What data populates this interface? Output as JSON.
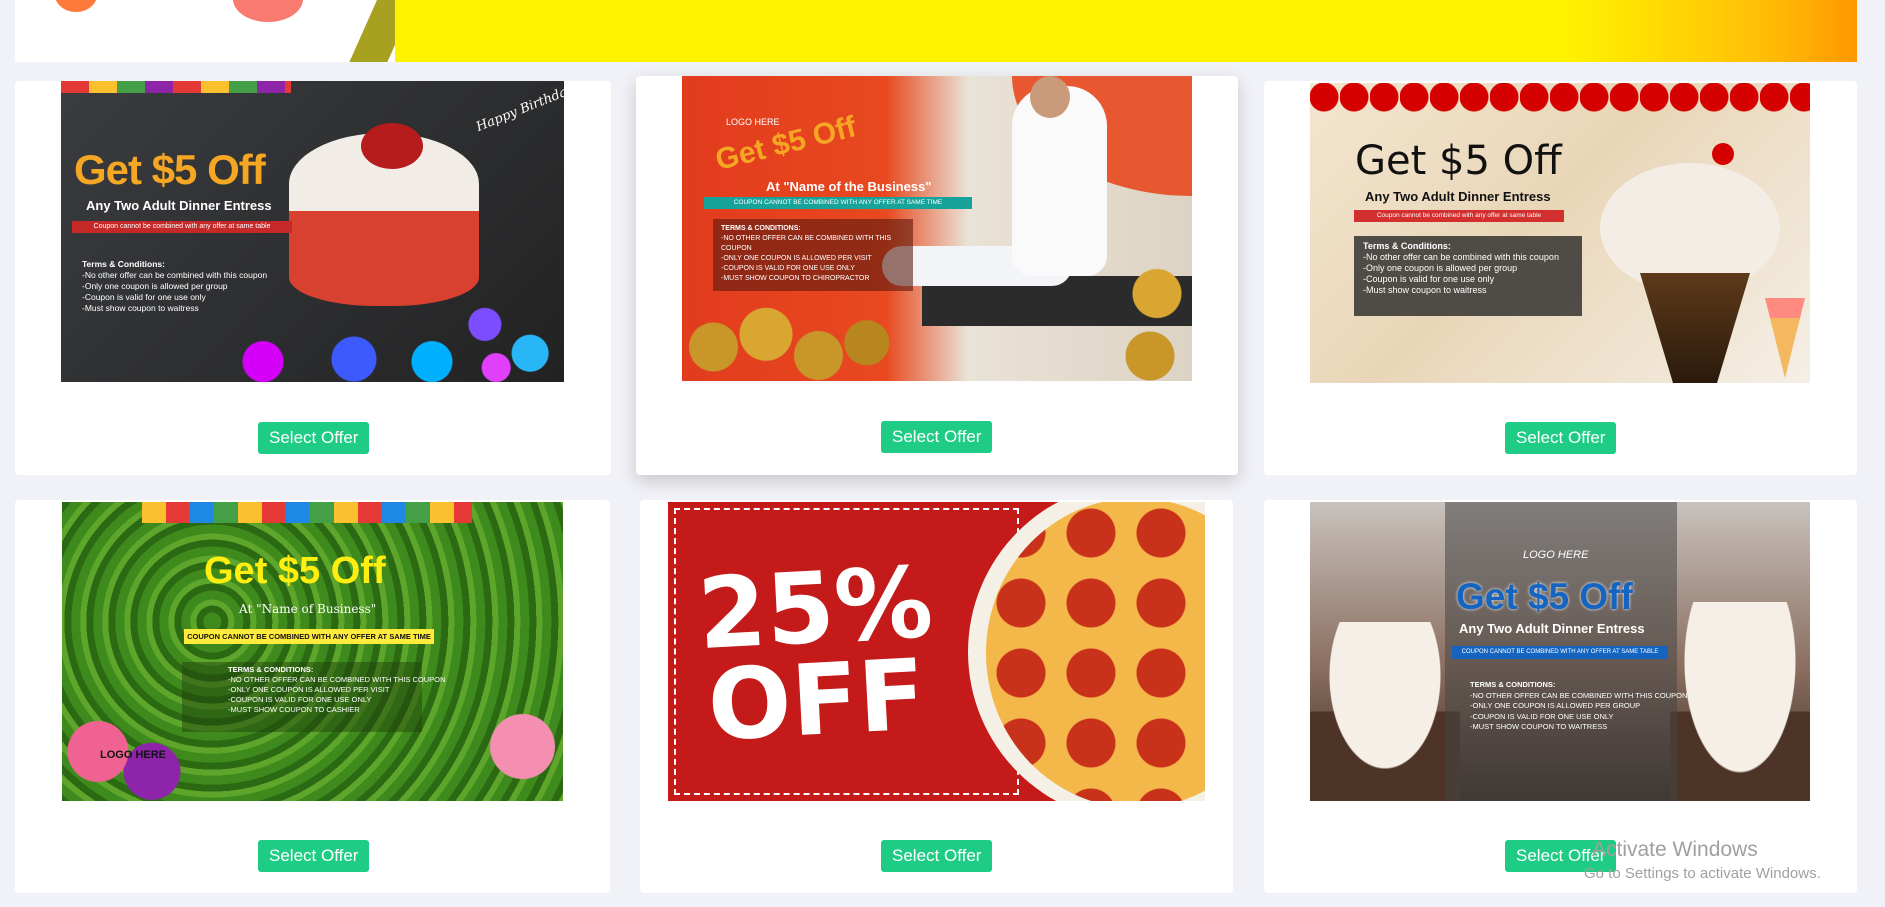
{
  "offers": [
    {
      "headline": "Get $5 Off",
      "subline": "Any Two Adult Dinner Entress",
      "disclaimer": "Coupon cannot be combined with any offer at same table",
      "terms_title": "Terms & Conditions:",
      "terms": [
        "-No other offer can be combined with this coupon",
        "-Only one coupon is allowed per group",
        "-Coupon is valid for one use only",
        "-Must show coupon to waitress"
      ],
      "decor": "Happy Birthday!",
      "button": "Select Offer"
    },
    {
      "logo": "LOGO HERE",
      "headline": "Get $5 Off",
      "subline": "At \"Name of the Business\"",
      "disclaimer": "COUPON CANNOT BE COMBINED WITH ANY OFFER AT SAME TIME",
      "terms_title": "TERMS & CONDITIONS:",
      "terms": [
        "-NO OTHER OFFER CAN BE COMBINED WITH THIS COUPON",
        "-ONLY ONE COUPON IS ALLOWED PER VISIT",
        "-COUPON IS VALID FOR ONE USE ONLY",
        "-MUST SHOW COUPON TO CHIROPRACTOR"
      ],
      "button": "Select Offer"
    },
    {
      "headline": "Get $5 Off",
      "subline": "Any Two Adult Dinner Entress",
      "disclaimer": "Coupon cannot be combined with any offer at same table",
      "terms_title": "Terms & Conditions:",
      "terms": [
        "-No other offer can be combined with this coupon",
        "-Only one coupon is allowed per group",
        "-Coupon is valid for one use only",
        "-Must show coupon to waitress"
      ],
      "button": "Select Offer"
    },
    {
      "headline": "Get $5 Off",
      "subline": "At \"Name of Business\"",
      "disclaimer": "COUPON CANNOT BE COMBINED WITH ANY OFFER AT SAME TIME",
      "terms_title": "TERMS & CONDITIONS:",
      "terms": [
        "-NO OTHER OFFER CAN BE COMBINED WITH THIS COUPON",
        "-ONLY ONE COUPON IS ALLOWED PER VISIT",
        "-COUPON IS VALID FOR ONE USE ONLY",
        "-MUST SHOW COUPON TO CASHIER"
      ],
      "logo": "LOGO HERE",
      "button": "Select Offer"
    },
    {
      "headline_top": "25%",
      "headline_bottom": "OFF",
      "button": "Select Offer"
    },
    {
      "logo": "LOGO HERE",
      "headline": "Get $5 Off",
      "subline": "Any Two Adult Dinner Entress",
      "disclaimer": "COUPON CANNOT BE COMBINED WITH ANY OFFER AT SAME TABLE",
      "terms_title": "TERMS & CONDITIONS:",
      "terms": [
        "-NO OTHER OFFER CAN BE COMBINED WITH THIS COUPON",
        "-ONLY ONE COUPON IS ALLOWED PER GROUP",
        "-COUPON IS VALID FOR ONE USE ONLY",
        "-MUST SHOW COUPON TO WAITRESS"
      ],
      "button": "Select Offer"
    }
  ],
  "watermark": {
    "title": "Activate Windows",
    "subtitle": "Go to Settings to activate Windows."
  },
  "colors": {
    "button": "#1fcc86",
    "page_bg": "#f1f2f7"
  }
}
